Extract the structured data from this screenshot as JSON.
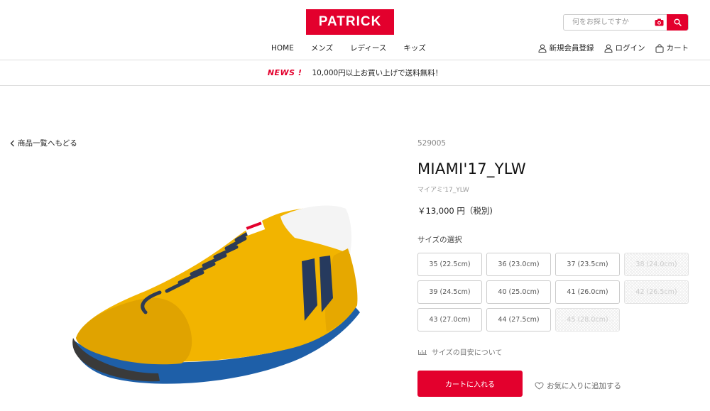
{
  "brand": {
    "logo_text": "PATRICK",
    "color": "#e3002d"
  },
  "search": {
    "placeholder": "何をお探しですか"
  },
  "main_nav": [
    "HOME",
    "メンズ",
    "レディース",
    "キッズ"
  ],
  "user_nav": {
    "register": "新規会員登録",
    "login": "ログイン",
    "cart": "カート"
  },
  "news_bar": {
    "tag": "NEWS !",
    "text": "10,000円以上お買い上げで送料無料！"
  },
  "back_link": "商品一覧へもどる",
  "product": {
    "code": "529005",
    "name": "MIAMI'17_YLW",
    "kana": "マイアミ'17_YLW",
    "price": "￥13,000 円（税別)",
    "size_label": "サイズの選択",
    "sizes": [
      {
        "label": "35 (22.5cm)",
        "available": true
      },
      {
        "label": "36 (23.0cm)",
        "available": true
      },
      {
        "label": "37 (23.5cm)",
        "available": true
      },
      {
        "label": "38 (24.0cm)",
        "available": false
      },
      {
        "label": "39 (24.5cm)",
        "available": true
      },
      {
        "label": "40 (25.0cm)",
        "available": true
      },
      {
        "label": "41 (26.0cm)",
        "available": true
      },
      {
        "label": "42 (26.5cm)",
        "available": false
      },
      {
        "label": "43 (27.0cm)",
        "available": true
      },
      {
        "label": "44 (27.5cm)",
        "available": true
      },
      {
        "label": "45 (28.0cm)",
        "available": false
      }
    ],
    "size_guide": "サイズの目安について",
    "add_to_cart": "カートに入れる",
    "favorite": "お気に入りに追加する"
  }
}
